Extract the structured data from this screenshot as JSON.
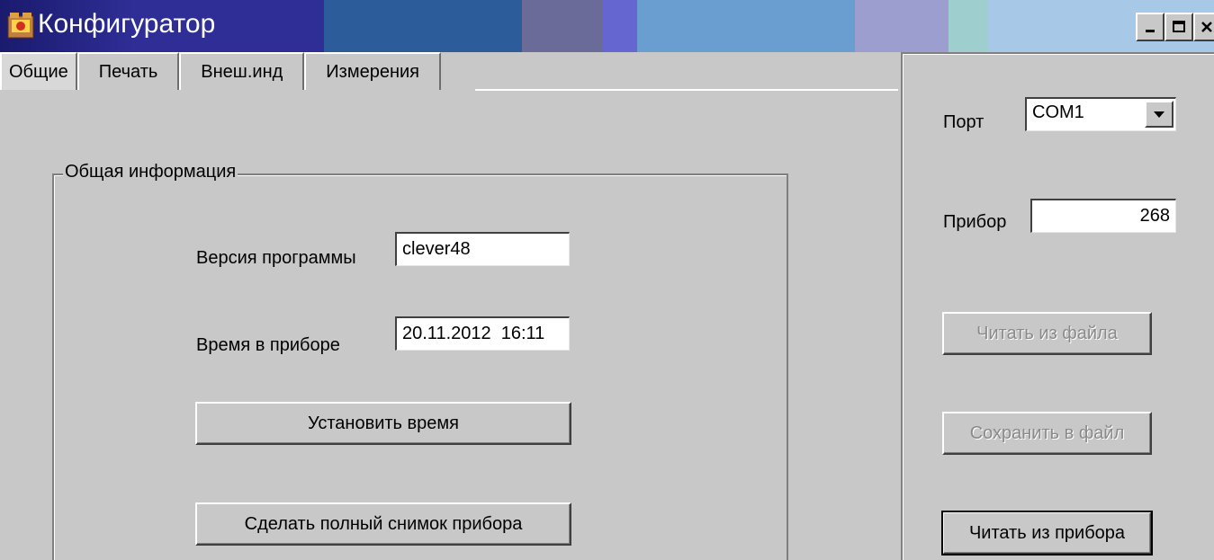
{
  "window": {
    "title": "Конфигуратор",
    "titlebar_colors": [
      "#2a2a8c",
      "#2c5c99",
      "#6b6b99",
      "#6b6bd0",
      "#6b9ed0",
      "#9c9ed0",
      "#9ecece",
      "#a8c8e8"
    ]
  },
  "tabs": [
    {
      "label": "Общие",
      "active": true
    },
    {
      "label": "Печать",
      "active": false
    },
    {
      "label": "Внеш.инд",
      "active": false
    },
    {
      "label": "Измерения",
      "active": false
    }
  ],
  "general_info": {
    "group_title": "Общая информация",
    "program_version_label": "Версия программы",
    "program_version_value": "clever48",
    "device_time_label": "Время в приборе",
    "device_time_value": "20.11.2012  16:11",
    "set_time_button": "Установить время",
    "full_snapshot_button": "Сделать полный снимок прибора"
  },
  "connection": {
    "port_label": "Порт",
    "port_value": "COM1",
    "device_label": "Прибор",
    "device_value": "268",
    "read_from_file_button": "Читать из файла",
    "save_to_file_button": "Сохранить в файл",
    "read_from_device_button": "Читать из прибора"
  }
}
